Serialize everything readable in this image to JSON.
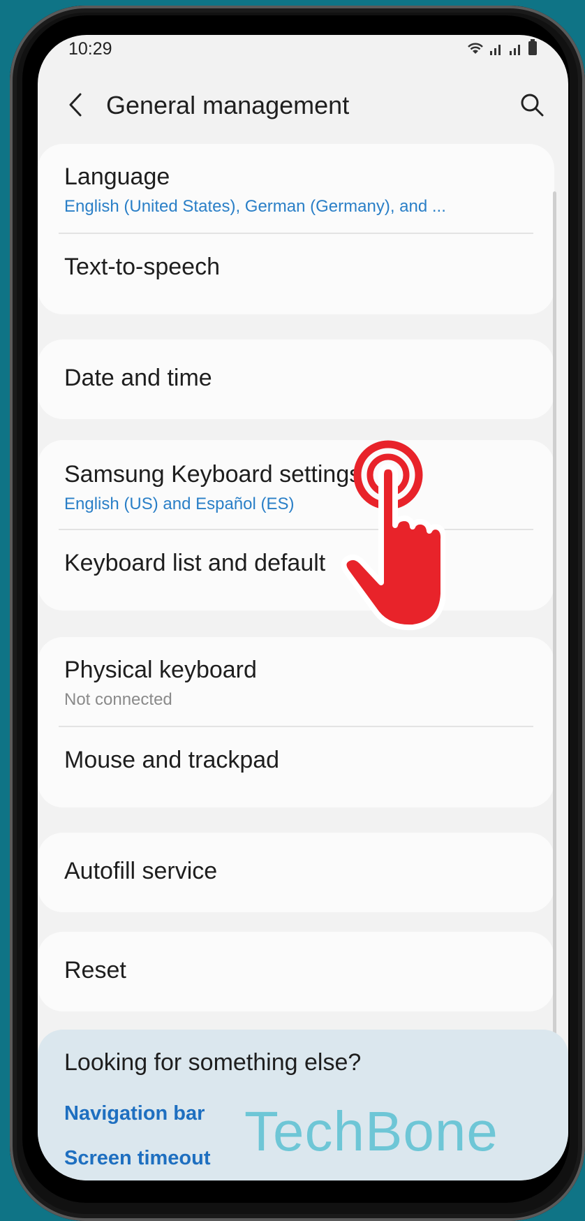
{
  "colors": {
    "background": "#0f7486",
    "link_blue": "#2a7fc7"
  },
  "status_bar": {
    "time": "10:29",
    "icons": [
      "wifi-icon",
      "signal-icon",
      "signal-icon",
      "battery-icon"
    ]
  },
  "app_bar": {
    "title": "General management",
    "back_icon": "chevron-left-icon",
    "search_icon": "search-icon"
  },
  "groups": [
    {
      "items": [
        {
          "title": "Language",
          "subtitle": "English (United States), German (Germany), and ..."
        },
        {
          "title": "Text-to-speech"
        }
      ]
    },
    {
      "items": [
        {
          "title": "Date and time"
        }
      ]
    },
    {
      "items": [
        {
          "title": "Samsung Keyboard settings",
          "subtitle": "English (US) and Español (ES)"
        },
        {
          "title": "Keyboard list and default"
        }
      ]
    },
    {
      "items": [
        {
          "title": "Physical keyboard",
          "subtitle": "Not connected"
        },
        {
          "title": "Mouse and trackpad"
        }
      ]
    },
    {
      "items": [
        {
          "title": "Autofill service"
        }
      ]
    },
    {
      "items": [
        {
          "title": "Reset"
        }
      ]
    }
  ],
  "suggestions": {
    "title": "Looking for something else?",
    "links": [
      "Navigation bar",
      "Screen timeout"
    ]
  },
  "watermark": "TechBone",
  "overlay_icon": "tap-hand-icon"
}
